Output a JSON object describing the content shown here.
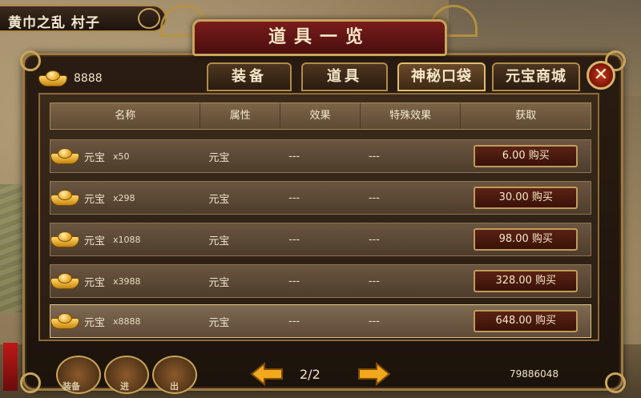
{
  "location": {
    "title": "黄巾之乱 村子"
  },
  "panel": {
    "title": "道具一览"
  },
  "gold": {
    "amount": "8888",
    "icon": "gold-ingot-icon"
  },
  "tabs": [
    {
      "label": "装备",
      "active": false
    },
    {
      "label": "道具",
      "active": false
    },
    {
      "label": "神秘口袋",
      "active": true
    },
    {
      "label": "元宝商城",
      "active": false
    }
  ],
  "close": {
    "label": "✕"
  },
  "table": {
    "headers": [
      "名称",
      "属性",
      "效果",
      "特殊效果",
      "获取"
    ],
    "rows": [
      {
        "name": "元宝",
        "amount": "x50",
        "attr": "元宝",
        "effect": "---",
        "special": "---",
        "buy": "6.00 购买",
        "selected": false
      },
      {
        "name": "元宝",
        "amount": "x298",
        "attr": "元宝",
        "effect": "---",
        "special": "---",
        "buy": "30.00 购买",
        "selected": false
      },
      {
        "name": "元宝",
        "amount": "x1088",
        "attr": "元宝",
        "effect": "---",
        "special": "---",
        "buy": "98.00 购买",
        "selected": false
      },
      {
        "name": "元宝",
        "amount": "x3988",
        "attr": "元宝",
        "effect": "---",
        "special": "---",
        "buy": "328.00 购买",
        "selected": false
      },
      {
        "name": "元宝",
        "amount": "x8888",
        "attr": "元宝",
        "effect": "---",
        "special": "---",
        "buy": "648.00 购买",
        "selected": true
      }
    ]
  },
  "pager": {
    "page": "2/2",
    "prev_icon": "arrow-left-icon",
    "next_icon": "arrow-right-icon"
  },
  "footer": {
    "total": "79886048"
  },
  "bottom_buttons": [
    {
      "label": "装备"
    },
    {
      "label": "进"
    },
    {
      "label": "出"
    }
  ]
}
